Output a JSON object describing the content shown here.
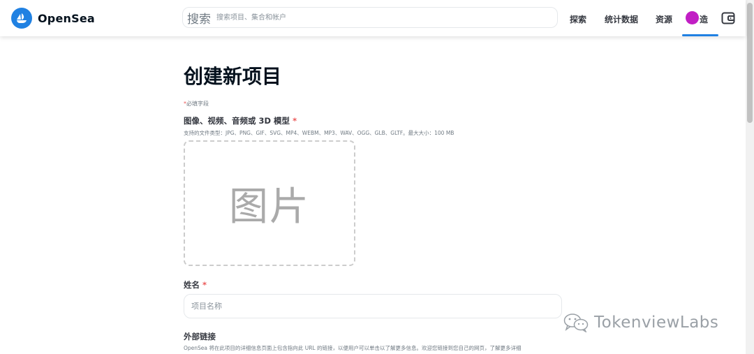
{
  "header": {
    "brand": "OpenSea",
    "search": {
      "icon_text": "搜索",
      "placeholder": "搜索项目、集合和帐户"
    },
    "nav": {
      "explore": "探索",
      "stats": "统计数据",
      "resources": "资源",
      "create": "造"
    }
  },
  "main": {
    "title": "创建新项目",
    "required_note": "必填字段",
    "required_star": "*",
    "media": {
      "label": "图像、视频、音频或 3D 模型",
      "help": "支持的文件类型：JPG、PNG、GIF、SVG、MP4、WEBM、MP3、WAV、OGG、GLB、GLTF。最大大小：100 MB",
      "placeholder_text": "图片"
    },
    "name": {
      "label": "姓名",
      "placeholder": "项目名称"
    },
    "external_link": {
      "label": "外部链接",
      "help": "OpenSea 将在此项目的详细信息页面上包含指向此 URL 的链接，以便用户可以单击以了解更多信息。欢迎您链接到您自己的网页，了解更多详细"
    }
  },
  "watermark": {
    "text": "TokenviewLabs"
  },
  "colors": {
    "accent": "#2081e2",
    "avatar": "#c11ec4",
    "required": "#eb5757"
  },
  "icons": {
    "logo": "opensea-logo-icon",
    "wallet": "wallet-icon",
    "watermark": "wechat-icon"
  }
}
